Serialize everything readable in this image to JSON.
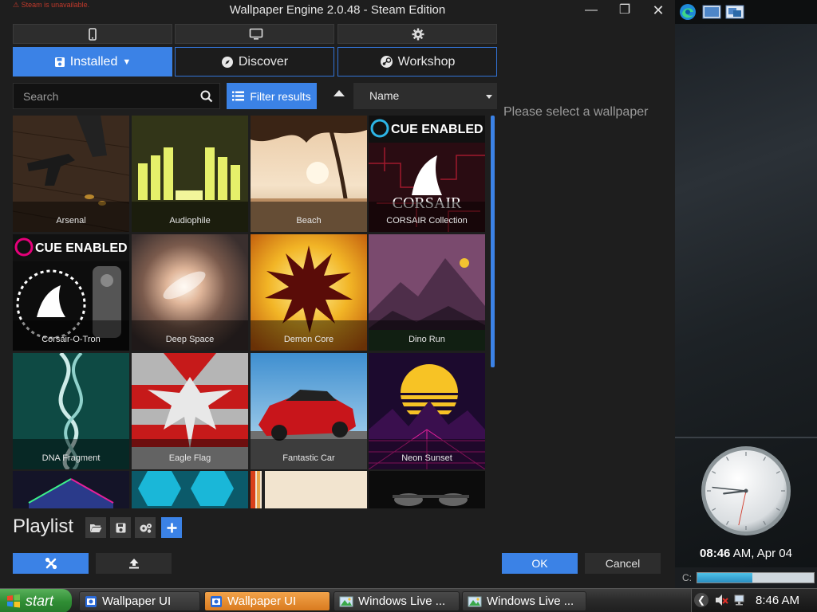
{
  "window": {
    "title": "Wallpaper Engine 2.0.48 - Steam Edition",
    "steam_warning": "Steam is unavailable."
  },
  "tabs": {
    "installed": "Installed",
    "discover": "Discover",
    "workshop": "Workshop"
  },
  "search": {
    "placeholder": "Search",
    "filter_label": "Filter results",
    "sort_value": "Name"
  },
  "wallpapers": [
    {
      "label": "Arsenal"
    },
    {
      "label": "Audiophile"
    },
    {
      "label": "Beach"
    },
    {
      "label": "CORSAIR Collection",
      "badge": "CUE ENABLED",
      "brand": "CORSAIR"
    },
    {
      "label": "Corsair-O-Tron",
      "badge": "CUE ENABLED"
    },
    {
      "label": "Deep Space"
    },
    {
      "label": "Demon Core"
    },
    {
      "label": "Dino Run"
    },
    {
      "label": "DNA Fragment"
    },
    {
      "label": "Eagle Flag"
    },
    {
      "label": "Fantastic Car"
    },
    {
      "label": "Neon Sunset"
    },
    {
      "label": ""
    },
    {
      "label": ""
    },
    {
      "label": ""
    },
    {
      "label": ""
    }
  ],
  "preview": {
    "message": "Please select a wallpaper"
  },
  "playlist": {
    "title": "Playlist"
  },
  "footer": {
    "ok": "OK",
    "cancel": "Cancel"
  },
  "desktop": {
    "clock_time": "08:46",
    "clock_rest": " AM, Apr 04",
    "drive_label": "C:",
    "drive_usage": 0.47,
    "clock_hands": {
      "hour": 8.77,
      "minute": 46,
      "second": 32
    }
  },
  "taskbar": {
    "start": "start",
    "tasks": [
      "Wallpaper UI",
      "Wallpaper UI",
      "Windows Live ...",
      "Windows Live ..."
    ],
    "tray_time": "8:46 AM"
  },
  "colors": {
    "accent": "#3b82e6",
    "active_task": "#d97b1f",
    "start_green": "#2f8d34"
  }
}
